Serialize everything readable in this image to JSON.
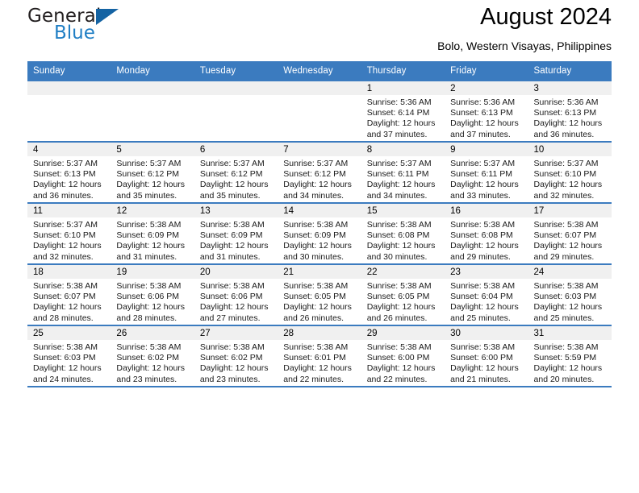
{
  "brand": {
    "name_part1": "General",
    "name_part2": "Blue",
    "logo_icon": "triangle-logo-icon"
  },
  "header": {
    "title": "August 2024",
    "subtitle": "Bolo, Western Visayas, Philippines"
  },
  "calendar": {
    "weekdays": [
      "Sunday",
      "Monday",
      "Tuesday",
      "Wednesday",
      "Thursday",
      "Friday",
      "Saturday"
    ],
    "accent_color": "#3b7bbf",
    "daynum_band_color": "#f0f0f0",
    "weeks": [
      [
        {
          "day": "",
          "sunrise": "",
          "sunset": "",
          "daylight_line1": "",
          "daylight_line2": ""
        },
        {
          "day": "",
          "sunrise": "",
          "sunset": "",
          "daylight_line1": "",
          "daylight_line2": ""
        },
        {
          "day": "",
          "sunrise": "",
          "sunset": "",
          "daylight_line1": "",
          "daylight_line2": ""
        },
        {
          "day": "",
          "sunrise": "",
          "sunset": "",
          "daylight_line1": "",
          "daylight_line2": ""
        },
        {
          "day": "1",
          "sunrise": "Sunrise: 5:36 AM",
          "sunset": "Sunset: 6:14 PM",
          "daylight_line1": "Daylight: 12 hours",
          "daylight_line2": "and 37 minutes."
        },
        {
          "day": "2",
          "sunrise": "Sunrise: 5:36 AM",
          "sunset": "Sunset: 6:13 PM",
          "daylight_line1": "Daylight: 12 hours",
          "daylight_line2": "and 37 minutes."
        },
        {
          "day": "3",
          "sunrise": "Sunrise: 5:36 AM",
          "sunset": "Sunset: 6:13 PM",
          "daylight_line1": "Daylight: 12 hours",
          "daylight_line2": "and 36 minutes."
        }
      ],
      [
        {
          "day": "4",
          "sunrise": "Sunrise: 5:37 AM",
          "sunset": "Sunset: 6:13 PM",
          "daylight_line1": "Daylight: 12 hours",
          "daylight_line2": "and 36 minutes."
        },
        {
          "day": "5",
          "sunrise": "Sunrise: 5:37 AM",
          "sunset": "Sunset: 6:12 PM",
          "daylight_line1": "Daylight: 12 hours",
          "daylight_line2": "and 35 minutes."
        },
        {
          "day": "6",
          "sunrise": "Sunrise: 5:37 AM",
          "sunset": "Sunset: 6:12 PM",
          "daylight_line1": "Daylight: 12 hours",
          "daylight_line2": "and 35 minutes."
        },
        {
          "day": "7",
          "sunrise": "Sunrise: 5:37 AM",
          "sunset": "Sunset: 6:12 PM",
          "daylight_line1": "Daylight: 12 hours",
          "daylight_line2": "and 34 minutes."
        },
        {
          "day": "8",
          "sunrise": "Sunrise: 5:37 AM",
          "sunset": "Sunset: 6:11 PM",
          "daylight_line1": "Daylight: 12 hours",
          "daylight_line2": "and 34 minutes."
        },
        {
          "day": "9",
          "sunrise": "Sunrise: 5:37 AM",
          "sunset": "Sunset: 6:11 PM",
          "daylight_line1": "Daylight: 12 hours",
          "daylight_line2": "and 33 minutes."
        },
        {
          "day": "10",
          "sunrise": "Sunrise: 5:37 AM",
          "sunset": "Sunset: 6:10 PM",
          "daylight_line1": "Daylight: 12 hours",
          "daylight_line2": "and 32 minutes."
        }
      ],
      [
        {
          "day": "11",
          "sunrise": "Sunrise: 5:37 AM",
          "sunset": "Sunset: 6:10 PM",
          "daylight_line1": "Daylight: 12 hours",
          "daylight_line2": "and 32 minutes."
        },
        {
          "day": "12",
          "sunrise": "Sunrise: 5:38 AM",
          "sunset": "Sunset: 6:09 PM",
          "daylight_line1": "Daylight: 12 hours",
          "daylight_line2": "and 31 minutes."
        },
        {
          "day": "13",
          "sunrise": "Sunrise: 5:38 AM",
          "sunset": "Sunset: 6:09 PM",
          "daylight_line1": "Daylight: 12 hours",
          "daylight_line2": "and 31 minutes."
        },
        {
          "day": "14",
          "sunrise": "Sunrise: 5:38 AM",
          "sunset": "Sunset: 6:09 PM",
          "daylight_line1": "Daylight: 12 hours",
          "daylight_line2": "and 30 minutes."
        },
        {
          "day": "15",
          "sunrise": "Sunrise: 5:38 AM",
          "sunset": "Sunset: 6:08 PM",
          "daylight_line1": "Daylight: 12 hours",
          "daylight_line2": "and 30 minutes."
        },
        {
          "day": "16",
          "sunrise": "Sunrise: 5:38 AM",
          "sunset": "Sunset: 6:08 PM",
          "daylight_line1": "Daylight: 12 hours",
          "daylight_line2": "and 29 minutes."
        },
        {
          "day": "17",
          "sunrise": "Sunrise: 5:38 AM",
          "sunset": "Sunset: 6:07 PM",
          "daylight_line1": "Daylight: 12 hours",
          "daylight_line2": "and 29 minutes."
        }
      ],
      [
        {
          "day": "18",
          "sunrise": "Sunrise: 5:38 AM",
          "sunset": "Sunset: 6:07 PM",
          "daylight_line1": "Daylight: 12 hours",
          "daylight_line2": "and 28 minutes."
        },
        {
          "day": "19",
          "sunrise": "Sunrise: 5:38 AM",
          "sunset": "Sunset: 6:06 PM",
          "daylight_line1": "Daylight: 12 hours",
          "daylight_line2": "and 28 minutes."
        },
        {
          "day": "20",
          "sunrise": "Sunrise: 5:38 AM",
          "sunset": "Sunset: 6:06 PM",
          "daylight_line1": "Daylight: 12 hours",
          "daylight_line2": "and 27 minutes."
        },
        {
          "day": "21",
          "sunrise": "Sunrise: 5:38 AM",
          "sunset": "Sunset: 6:05 PM",
          "daylight_line1": "Daylight: 12 hours",
          "daylight_line2": "and 26 minutes."
        },
        {
          "day": "22",
          "sunrise": "Sunrise: 5:38 AM",
          "sunset": "Sunset: 6:05 PM",
          "daylight_line1": "Daylight: 12 hours",
          "daylight_line2": "and 26 minutes."
        },
        {
          "day": "23",
          "sunrise": "Sunrise: 5:38 AM",
          "sunset": "Sunset: 6:04 PM",
          "daylight_line1": "Daylight: 12 hours",
          "daylight_line2": "and 25 minutes."
        },
        {
          "day": "24",
          "sunrise": "Sunrise: 5:38 AM",
          "sunset": "Sunset: 6:03 PM",
          "daylight_line1": "Daylight: 12 hours",
          "daylight_line2": "and 25 minutes."
        }
      ],
      [
        {
          "day": "25",
          "sunrise": "Sunrise: 5:38 AM",
          "sunset": "Sunset: 6:03 PM",
          "daylight_line1": "Daylight: 12 hours",
          "daylight_line2": "and 24 minutes."
        },
        {
          "day": "26",
          "sunrise": "Sunrise: 5:38 AM",
          "sunset": "Sunset: 6:02 PM",
          "daylight_line1": "Daylight: 12 hours",
          "daylight_line2": "and 23 minutes."
        },
        {
          "day": "27",
          "sunrise": "Sunrise: 5:38 AM",
          "sunset": "Sunset: 6:02 PM",
          "daylight_line1": "Daylight: 12 hours",
          "daylight_line2": "and 23 minutes."
        },
        {
          "day": "28",
          "sunrise": "Sunrise: 5:38 AM",
          "sunset": "Sunset: 6:01 PM",
          "daylight_line1": "Daylight: 12 hours",
          "daylight_line2": "and 22 minutes."
        },
        {
          "day": "29",
          "sunrise": "Sunrise: 5:38 AM",
          "sunset": "Sunset: 6:00 PM",
          "daylight_line1": "Daylight: 12 hours",
          "daylight_line2": "and 22 minutes."
        },
        {
          "day": "30",
          "sunrise": "Sunrise: 5:38 AM",
          "sunset": "Sunset: 6:00 PM",
          "daylight_line1": "Daylight: 12 hours",
          "daylight_line2": "and 21 minutes."
        },
        {
          "day": "31",
          "sunrise": "Sunrise: 5:38 AM",
          "sunset": "Sunset: 5:59 PM",
          "daylight_line1": "Daylight: 12 hours",
          "daylight_line2": "and 20 minutes."
        }
      ]
    ]
  }
}
